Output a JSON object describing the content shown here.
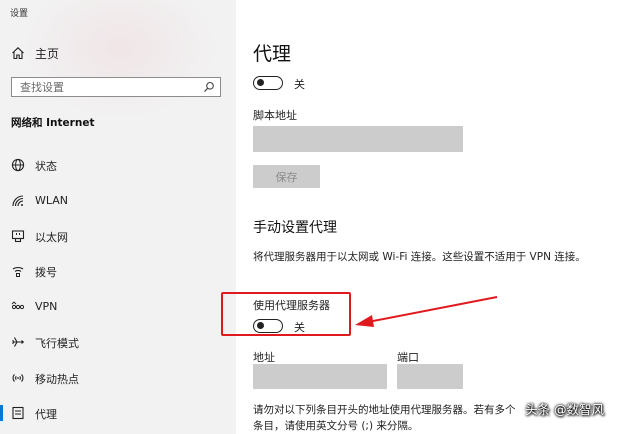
{
  "window": {
    "title": "设置"
  },
  "sidebar": {
    "home_label": "主页",
    "search_placeholder": "查找设置",
    "section_title": "网络和 Internet",
    "items": [
      {
        "label": "状态",
        "icon": "globe-status-icon"
      },
      {
        "label": "WLAN",
        "icon": "wifi-icon"
      },
      {
        "label": "以太网",
        "icon": "ethernet-icon"
      },
      {
        "label": "拨号",
        "icon": "dialup-icon"
      },
      {
        "label": "VPN",
        "icon": "vpn-icon"
      },
      {
        "label": "飞行模式",
        "icon": "airplane-icon"
      },
      {
        "label": "移动热点",
        "icon": "hotspot-icon"
      },
      {
        "label": "代理",
        "icon": "proxy-icon",
        "selected": true
      }
    ]
  },
  "main": {
    "title": "代理",
    "auto_setup": {
      "toggle_state": "关",
      "script_address_label": "脚本地址",
      "script_address_value": "",
      "save_label": "保存"
    },
    "manual_setup": {
      "heading": "手动设置代理",
      "description": "将代理服务器用于以太网或 Wi-Fi 连接。这些设置不适用于 VPN 连接。",
      "use_proxy_label": "使用代理服务器",
      "toggle_state": "关",
      "address_label": "地址",
      "address_value": "",
      "port_label": "端口",
      "port_value": "",
      "exceptions_description": "请勿对以下列条目开头的地址使用代理服务器。若有多个条目，请使用英文分号 (;) 来分隔。"
    }
  },
  "overlay": {
    "watermark": "头条 @数智风",
    "highlight_color": "#e0191f"
  }
}
